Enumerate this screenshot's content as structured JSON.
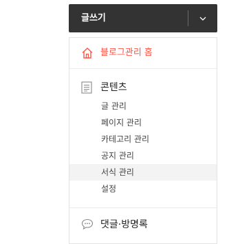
{
  "write_button": {
    "label": "글쓰기"
  },
  "menu": {
    "home": {
      "label": "블로그관리 홈"
    },
    "sections": [
      {
        "label": "콘텐츠",
        "icon": "document-icon",
        "items": [
          {
            "label": "글 관리",
            "active": false
          },
          {
            "label": "페이지 관리",
            "active": false
          },
          {
            "label": "카테고리 관리",
            "active": false
          },
          {
            "label": "공지 관리",
            "active": false
          },
          {
            "label": "서식 관리",
            "active": true
          },
          {
            "label": "설정",
            "active": false
          }
        ]
      },
      {
        "label": "댓글·방명록",
        "icon": "speech-bubble-icon",
        "items": []
      }
    ]
  },
  "colors": {
    "accent": "#ff5544",
    "bar": "#333333",
    "active_row": "#f3f3f3"
  }
}
